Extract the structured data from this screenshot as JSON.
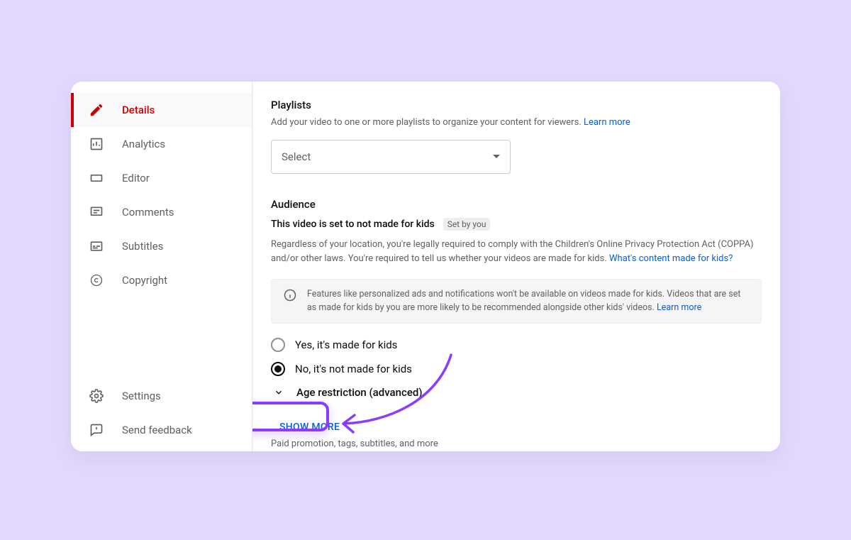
{
  "sidebar": {
    "items": [
      {
        "label": "Details"
      },
      {
        "label": "Analytics"
      },
      {
        "label": "Editor"
      },
      {
        "label": "Comments"
      },
      {
        "label": "Subtitles"
      },
      {
        "label": "Copyright"
      }
    ],
    "footer": [
      {
        "label": "Settings"
      },
      {
        "label": "Send feedback"
      }
    ]
  },
  "playlists": {
    "title": "Playlists",
    "help": "Add your video to one or more playlists to organize your content for viewers.",
    "learn_more": "Learn more",
    "select_placeholder": "Select"
  },
  "audience": {
    "title": "Audience",
    "status": "This video is set to not made for kids",
    "badge": "Set by you",
    "coppa_text": "Regardless of your location, you're legally required to comply with the Children's Online Privacy Protection Act (COPPA) and/or other laws. You're required to tell us whether your videos are made for kids.",
    "coppa_link": "What's content made for kids?",
    "info_text": "Features like personalized ads and notifications won't be available on videos made for kids. Videos that are set as made for kids by you are more likely to be recommended alongside other kids' videos.",
    "info_link": "Learn more",
    "radio_yes": "Yes, it's made for kids",
    "radio_no": "No, it's not made for kids",
    "age_restriction": "Age restriction (advanced)"
  },
  "show_more": {
    "label": "SHOW MORE",
    "hint": "Paid promotion, tags, subtitles, and more"
  }
}
